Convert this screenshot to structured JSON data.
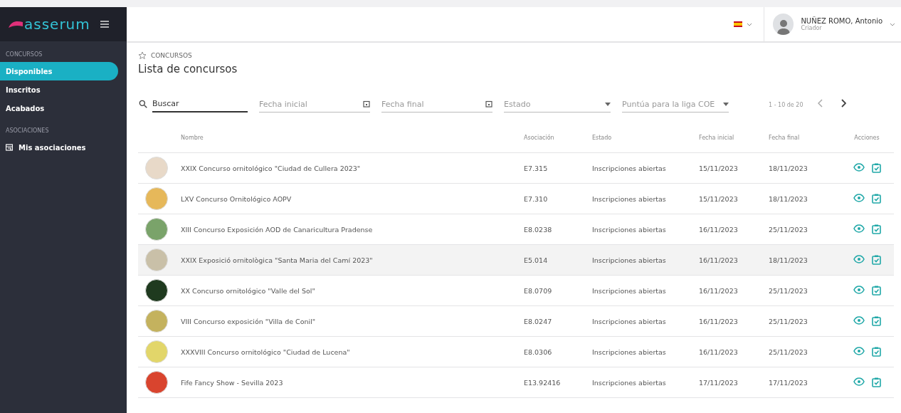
{
  "brand": {
    "name": "asserum"
  },
  "sidebar": {
    "sections": [
      {
        "title": "CONCURSOS",
        "items": [
          {
            "label": "Disponibles",
            "selected": true,
            "kind": "plain"
          },
          {
            "label": "Inscritos",
            "selected": false,
            "kind": "plain"
          },
          {
            "label": "Acabados",
            "selected": false,
            "kind": "plain"
          }
        ]
      },
      {
        "title": "ASOCIACIONES",
        "items": [
          {
            "label": "Mis asociaciones",
            "selected": false,
            "kind": "icon"
          }
        ]
      }
    ]
  },
  "user": {
    "name": "NUÑEZ ROMO, Antonio",
    "role": "Criador"
  },
  "breadcrumb": "CONCURSOS",
  "title": "Lista de concursos",
  "filters": [
    {
      "kind": "search",
      "value": "Buscar"
    },
    {
      "kind": "date",
      "placeholder": "Fecha inicial"
    },
    {
      "kind": "date",
      "placeholder": "Fecha final"
    },
    {
      "kind": "select",
      "placeholder": "Estado"
    },
    {
      "kind": "select",
      "placeholder": "Puntúa para la liga COE"
    }
  ],
  "pagination": "1 - 10 de 20",
  "table": {
    "columns": [
      "Nombre",
      "Asociación",
      "Estado",
      "Fecha inicial",
      "Fecha final",
      "Acciones"
    ],
    "rows": [
      {
        "name": "XXIX Concurso ornitológico \"Ciudad de Cullera 2023\"",
        "association": "E7.315",
        "status": "Inscripciones abiertas",
        "start": "15/11/2023",
        "end": "18/11/2023",
        "highlighted": false,
        "color": "#e8d9c8"
      },
      {
        "name": "LXV Concurso Ornitológico AOPV",
        "association": "E7.310",
        "status": "Inscripciones abiertas",
        "start": "15/11/2023",
        "end": "18/11/2023",
        "highlighted": false,
        "color": "#e6b85a"
      },
      {
        "name": "XIII Concurso Exposición AOD de Canaricultura Pradense",
        "association": "E8.0238",
        "status": "Inscripciones abiertas",
        "start": "16/11/2023",
        "end": "25/11/2023",
        "highlighted": false,
        "color": "#7aa36a"
      },
      {
        "name": "XXIX Exposició ornitològica \"Santa Maria del Camí 2023\"",
        "association": "E5.014",
        "status": "Inscripciones abiertas",
        "start": "16/11/2023",
        "end": "18/11/2023",
        "highlighted": true,
        "color": "#c9c0a8"
      },
      {
        "name": "XX Concurso ornitológico \"Valle del Sol\"",
        "association": "E8.0709",
        "status": "Inscripciones abiertas",
        "start": "16/11/2023",
        "end": "25/11/2023",
        "highlighted": false,
        "color": "#1f3a1f"
      },
      {
        "name": "VIII Concurso exposición \"Villa de Conil\"",
        "association": "E8.0247",
        "status": "Inscripciones abiertas",
        "start": "16/11/2023",
        "end": "25/11/2023",
        "highlighted": false,
        "color": "#c4b25e"
      },
      {
        "name": "XXXVIII Concurso ornitológico \"Ciudad de Lucena\"",
        "association": "E8.0306",
        "status": "Inscripciones abiertas",
        "start": "16/11/2023",
        "end": "25/11/2023",
        "highlighted": false,
        "color": "#e2d66a"
      },
      {
        "name": "Fife Fancy Show - Sevilla 2023",
        "association": "E13.92416",
        "status": "Inscripciones abiertas",
        "start": "17/11/2023",
        "end": "17/11/2023",
        "highlighted": false,
        "color": "#d9442e"
      }
    ]
  }
}
